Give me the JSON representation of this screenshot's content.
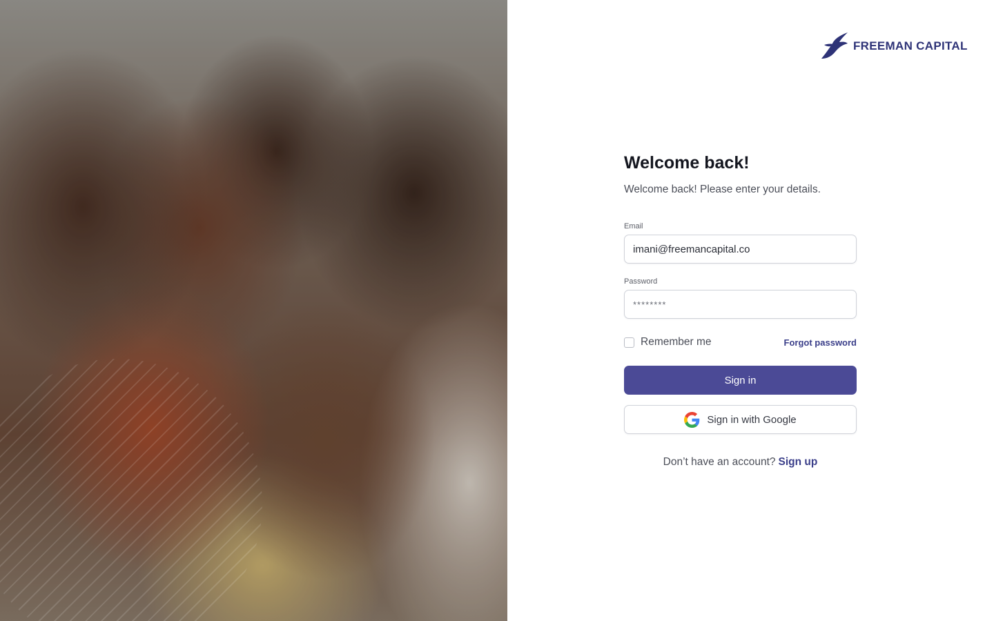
{
  "brand": {
    "name": "FREEMAN CAPITAL",
    "color": "#2e3377",
    "logo_icon": "bird-icon"
  },
  "hero": {
    "image": "family-hug-photo"
  },
  "form": {
    "title": "Welcome back!",
    "subtitle": "Welcome back! Please enter your details.",
    "email_label": "Email",
    "email_value": "imani@freemancapital.co",
    "password_label": "Password",
    "password_value": "********",
    "remember_label": "Remember me",
    "remember_checked": false,
    "forgot_label": "Forgot password",
    "sign_in_label": "Sign in",
    "google_label": "Sign in with Google",
    "google_icon": "google-icon",
    "no_account_text": "Don’t have an account?",
    "sign_up_label": "Sign up"
  },
  "colors": {
    "primary": "#4b4a96",
    "link": "#3b3f8a",
    "text": "#14161f"
  }
}
